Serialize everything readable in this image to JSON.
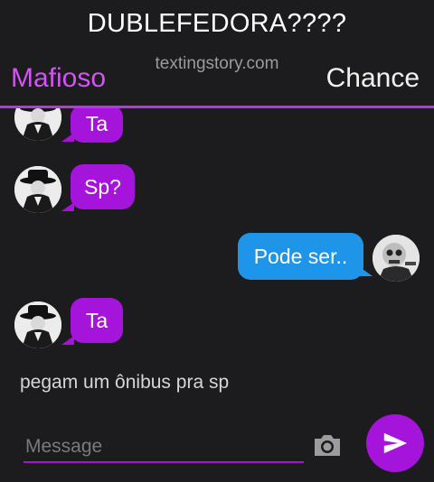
{
  "header": {
    "title": "DUBLEFEDORA????",
    "watermark": "textingstory.com",
    "left_contact": "Mafioso",
    "right_contact": "Chance"
  },
  "messages": [
    {
      "side": "left",
      "text": "Ta",
      "avatar": "fedora-man-avatar"
    },
    {
      "side": "left",
      "text": "Sp?",
      "avatar": "fedora-man-avatar"
    },
    {
      "side": "right",
      "text": "Pode ser..",
      "avatar": "skull-mask-avatar"
    },
    {
      "side": "left",
      "text": "Ta",
      "avatar": "fedora-man-avatar"
    }
  ],
  "narration": "pegam um ônibus pra sp",
  "composer": {
    "placeholder": "Message",
    "camera_icon": "camera-icon",
    "send_icon": "send-icon"
  },
  "colors": {
    "background": "#1c1b1d",
    "left_bubble": "#a414da",
    "right_bubble": "#1e95e8",
    "left_name": "#d354f2",
    "divider": "#b638e0"
  }
}
